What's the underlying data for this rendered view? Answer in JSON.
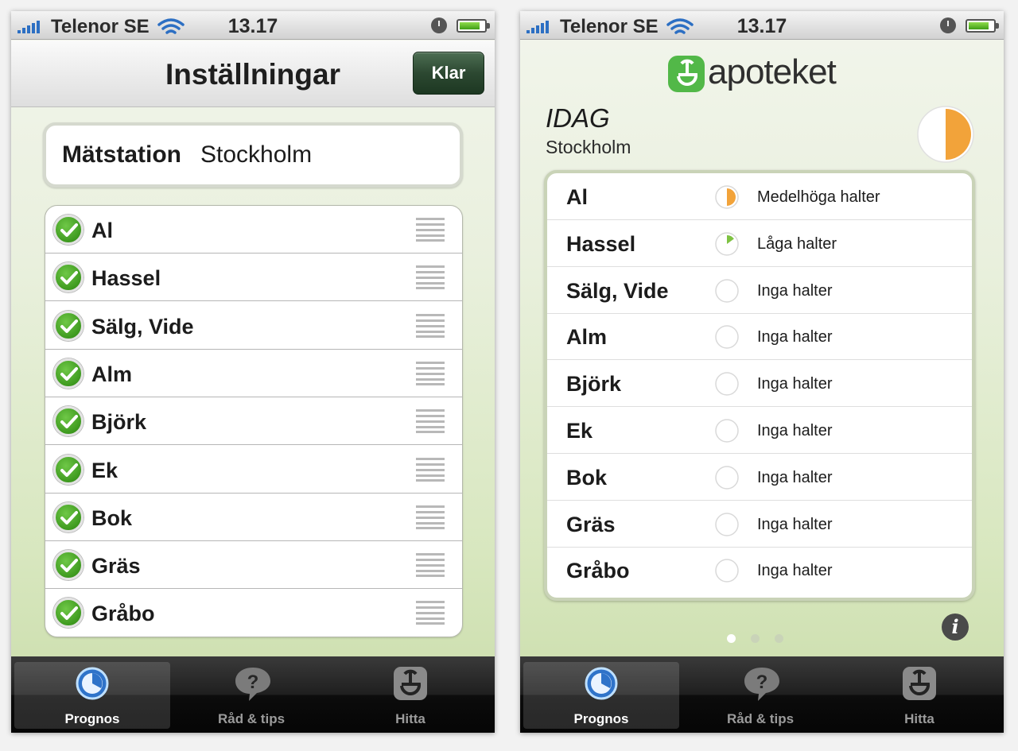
{
  "status_bar": {
    "carrier": "Telenor SE",
    "time": "13.17"
  },
  "settings_screen": {
    "title": "Inställningar",
    "done_button": "Klar",
    "station_label": "Mätstation",
    "station_value": "Stockholm",
    "pollen_items": [
      "Al",
      "Hassel",
      "Sälg, Vide",
      "Alm",
      "Björk",
      "Ek",
      "Bok",
      "Gräs",
      "Gråbo"
    ]
  },
  "forecast_screen": {
    "logo_text": "apoteket",
    "day_label": "IDAG",
    "city": "Stockholm",
    "overall_level_fraction": 0.5,
    "rows": [
      {
        "name": "Al",
        "level": "Medelhöga halter",
        "fraction": 0.5,
        "color": "#f2a33a"
      },
      {
        "name": "Hassel",
        "level": "Låga halter",
        "fraction": 0.15,
        "color": "#7ec242"
      },
      {
        "name": "Sälg, Vide",
        "level": "Inga halter",
        "fraction": 0
      },
      {
        "name": "Alm",
        "level": "Inga halter",
        "fraction": 0
      },
      {
        "name": "Björk",
        "level": "Inga halter",
        "fraction": 0
      },
      {
        "name": "Ek",
        "level": "Inga halter",
        "fraction": 0
      },
      {
        "name": "Bok",
        "level": "Inga halter",
        "fraction": 0
      },
      {
        "name": "Gräs",
        "level": "Inga halter",
        "fraction": 0
      },
      {
        "name": "Gråbo",
        "level": "Inga halter",
        "fraction": 0
      }
    ],
    "page_count": 3,
    "page_active": 1
  },
  "tab_bar": {
    "tabs": [
      {
        "label": "Prognos",
        "icon": "clock-pie-icon",
        "active": true
      },
      {
        "label": "Råd & tips",
        "icon": "question-bubble-icon",
        "active": false
      },
      {
        "label": "Hitta",
        "icon": "apoteket-logo-icon",
        "active": false
      }
    ]
  },
  "colors": {
    "accent_green": "#3e9a1f",
    "medium_level": "#f2a33a",
    "low_level": "#7ec242",
    "done_button": "#2c4831"
  }
}
